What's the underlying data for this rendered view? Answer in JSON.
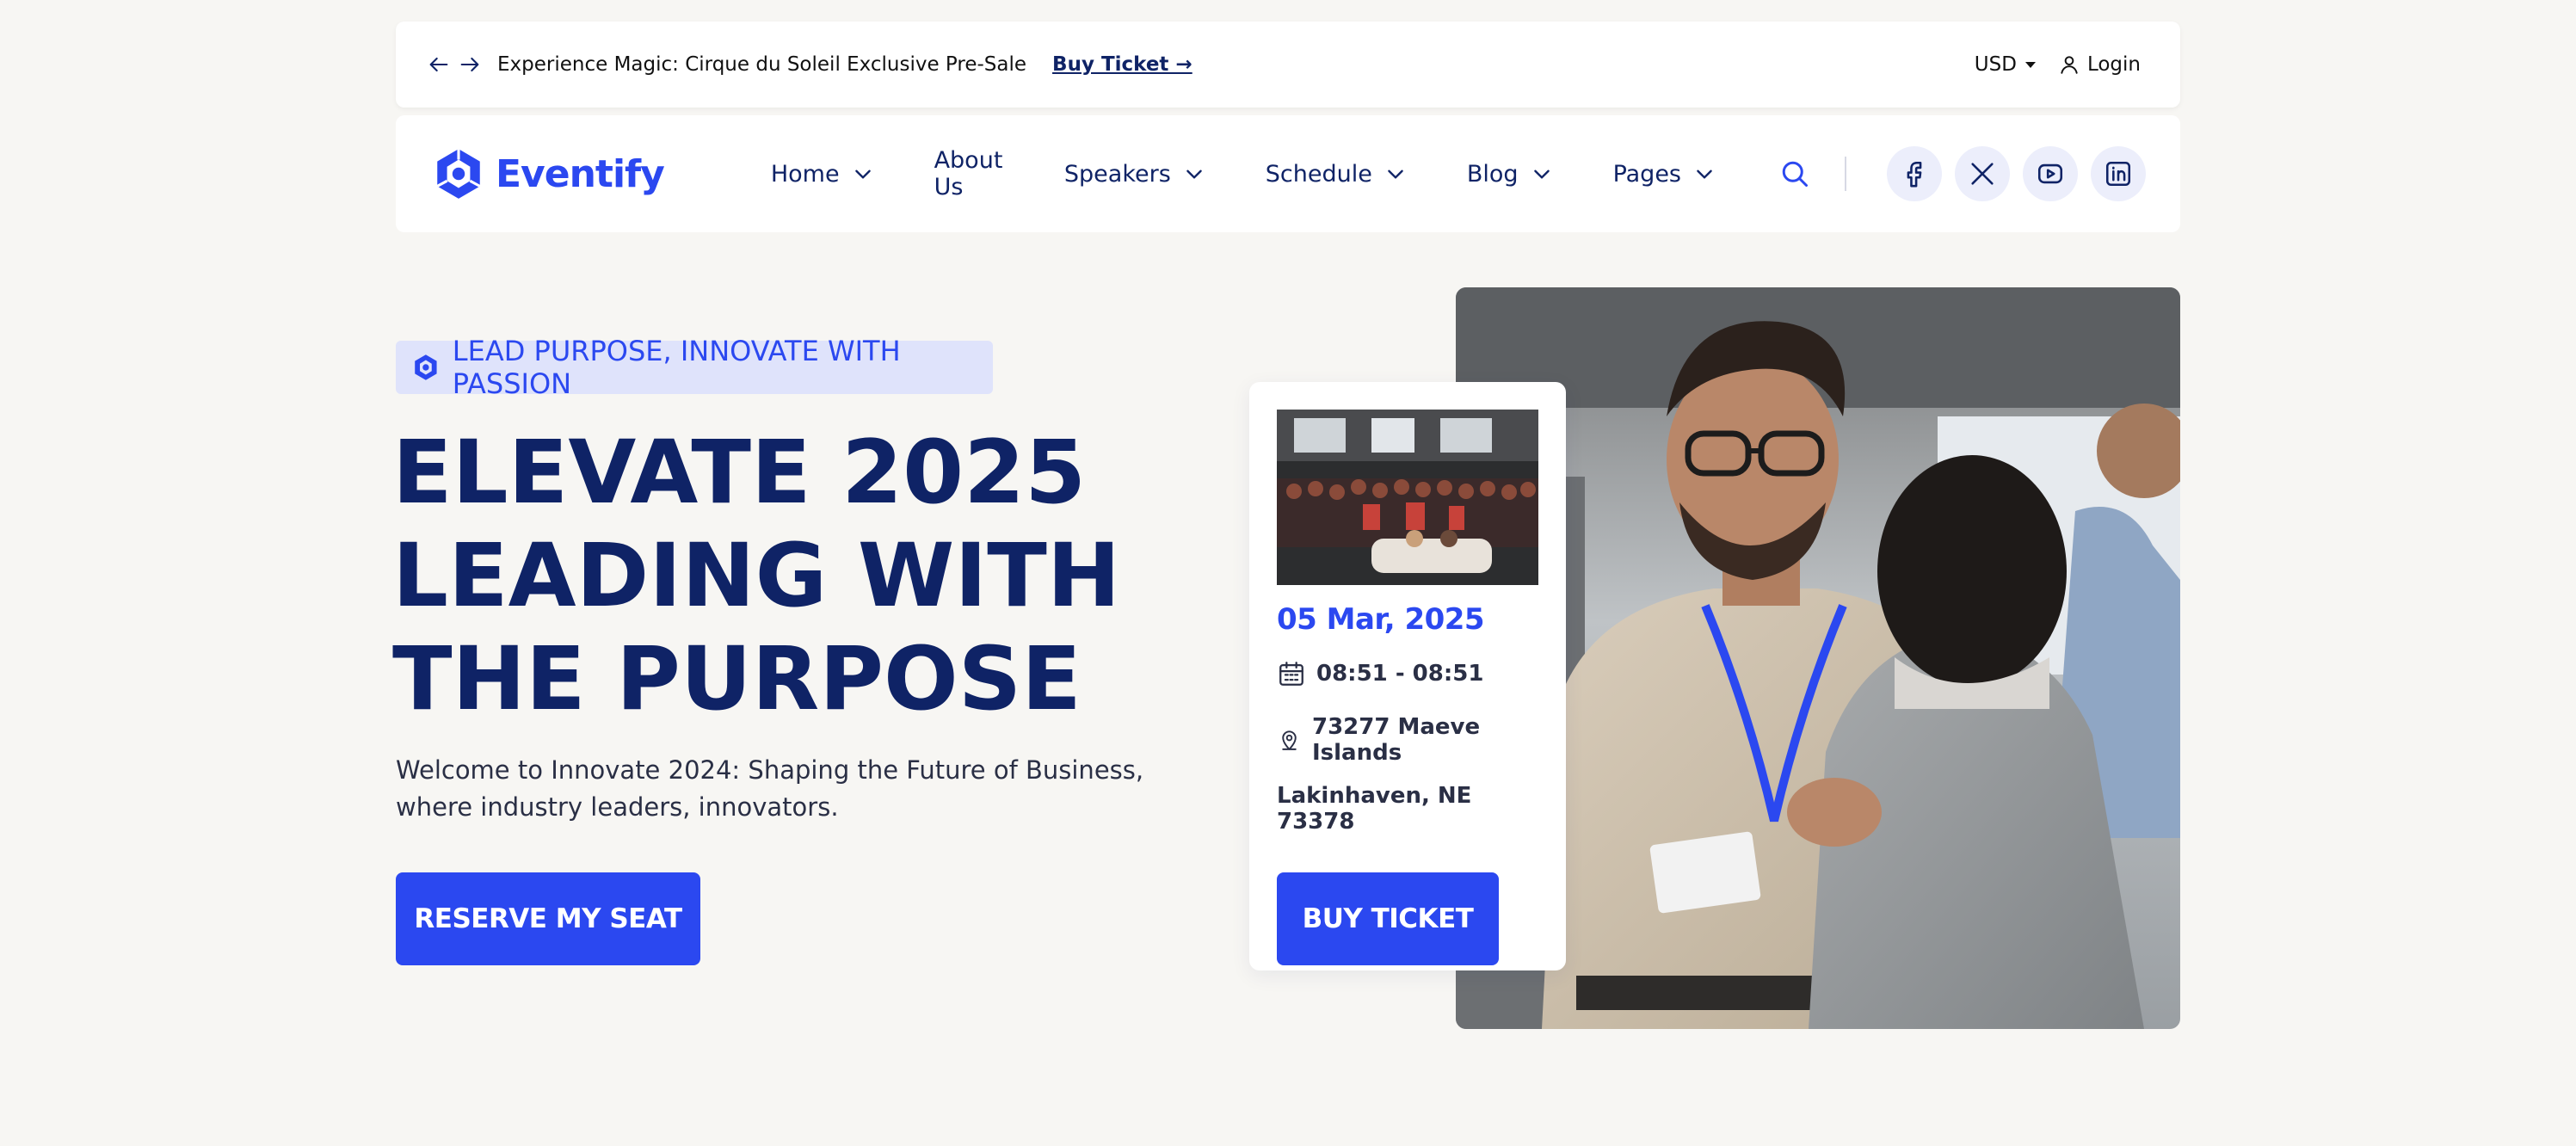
{
  "topbar": {
    "promo": "Experience Magic: Cirque du Soleil Exclusive Pre-Sale",
    "buy_link": "Buy Ticket →",
    "currency": "USD",
    "login": "Login"
  },
  "nav": {
    "logo": "Eventify",
    "items": [
      {
        "label": "Home",
        "dropdown": true
      },
      {
        "label": "About Us",
        "dropdown": false
      },
      {
        "label": "Speakers",
        "dropdown": true
      },
      {
        "label": "Schedule",
        "dropdown": true
      },
      {
        "label": "Blog",
        "dropdown": true
      },
      {
        "label": "Pages",
        "dropdown": true
      }
    ],
    "social": [
      "facebook-icon",
      "x-icon",
      "youtube-icon",
      "linkedin-icon"
    ]
  },
  "hero": {
    "badge": "LEAD PURPOSE, INNOVATE WITH PASSION",
    "headline": [
      "ELEVATE 2025",
      "LEADING WITH",
      "THE PURPOSE"
    ],
    "lead": "Welcome to Innovate 2024: Shaping the Future of Business, where industry leaders, innovators.",
    "cta": "RESERVE MY SEAT"
  },
  "event_card": {
    "date": "05 Mar, 2025",
    "time": "08:51 - 08:51",
    "address_line1": "73277 Maeve Islands",
    "address_line2": "Lakinhaven, NE 73378",
    "cta": "BUY TICKET"
  },
  "colors": {
    "brand": "#2b48f0",
    "navy": "#0f2366",
    "background": "#f7f6f3",
    "badge_bg": "#dfe3fb"
  }
}
